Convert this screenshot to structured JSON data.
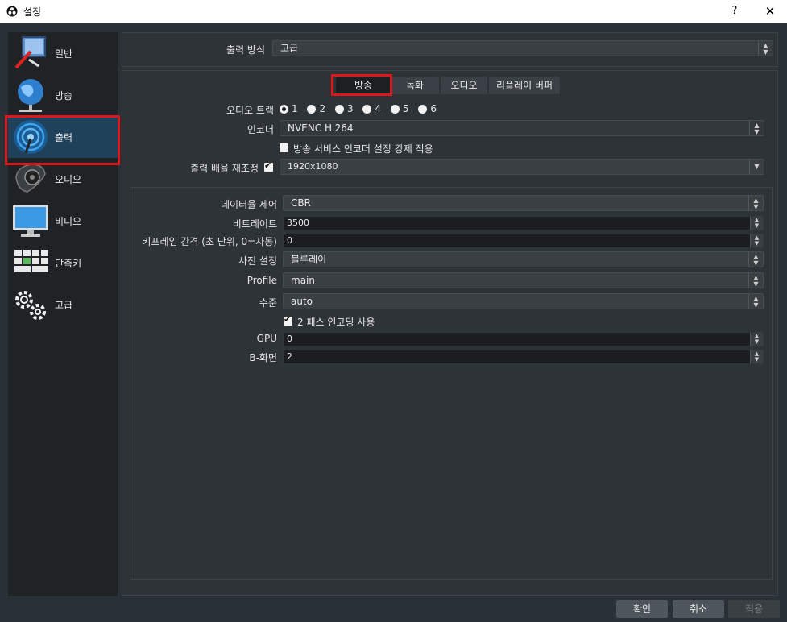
{
  "window": {
    "title": "설정",
    "help": "?",
    "close": "✕"
  },
  "sidebar": {
    "items": [
      {
        "label": "일반",
        "icon": "general-icon"
      },
      {
        "label": "방송",
        "icon": "stream-globe-icon"
      },
      {
        "label": "출력",
        "icon": "output-broadcast-icon",
        "active": true
      },
      {
        "label": "오디오",
        "icon": "speaker-icon"
      },
      {
        "label": "비디오",
        "icon": "monitor-icon"
      },
      {
        "label": "단축키",
        "icon": "keyboard-icon"
      },
      {
        "label": "고급",
        "icon": "gears-icon"
      }
    ]
  },
  "output_mode": {
    "label": "출력 방식",
    "value": "고급"
  },
  "tabs": [
    {
      "label": "방송",
      "active": true
    },
    {
      "label": "녹화"
    },
    {
      "label": "오디오"
    },
    {
      "label": "리플레이 버퍼"
    }
  ],
  "stream": {
    "audio_track": {
      "label": "오디오 트랙",
      "options": [
        "1",
        "2",
        "3",
        "4",
        "5",
        "6"
      ],
      "selected": "1"
    },
    "encoder": {
      "label": "인코더",
      "value": "NVENC H.264"
    },
    "enforce": {
      "label": "방송 서비스 인코더 설정 강제 적용",
      "checked": false
    },
    "rescale": {
      "label": "출력 배율 재조정",
      "checked": true,
      "value": "1920x1080"
    }
  },
  "encoder_settings": {
    "rate_control": {
      "label": "데이터율 제어",
      "value": "CBR"
    },
    "bitrate": {
      "label": "비트레이트",
      "value": "3500"
    },
    "keyframe": {
      "label": "키프레임 간격 (초 단위, 0=자동)",
      "value": "0"
    },
    "preset": {
      "label": "사전 설정",
      "value": "블루레이"
    },
    "profile": {
      "label": "Profile",
      "value": "main"
    },
    "level": {
      "label": "수준",
      "value": "auto"
    },
    "two_pass": {
      "label": "2 패스 인코딩 사용",
      "checked": true
    },
    "gpu": {
      "label": "GPU",
      "value": "0"
    },
    "bframes": {
      "label": "B-화면",
      "value": "2"
    }
  },
  "buttons": {
    "ok": "확인",
    "cancel": "취소",
    "apply": "적용"
  },
  "colors": {
    "highlight": "#e0161d",
    "active_sidebar": "#20415a",
    "background": "#293137"
  }
}
